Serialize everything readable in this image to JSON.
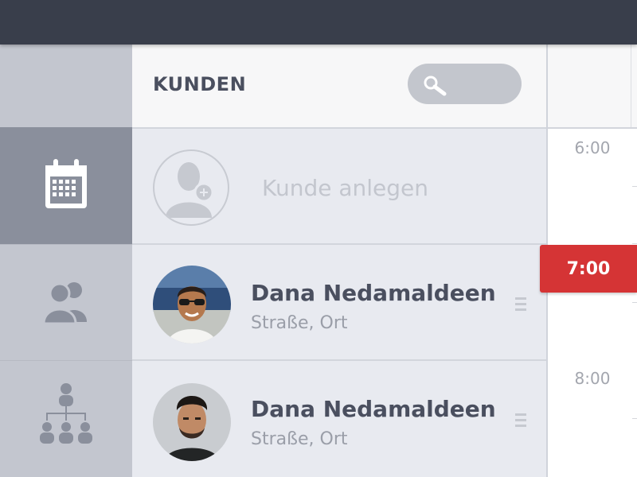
{
  "header": {
    "title": "KUNDEN"
  },
  "sidebar": {
    "items": [
      {
        "icon": "calendar-icon",
        "active": true
      },
      {
        "icon": "users-icon",
        "active": false
      },
      {
        "icon": "org-chart-icon",
        "active": false
      }
    ]
  },
  "add_customer": {
    "label": "Kunde anlegen"
  },
  "customers": [
    {
      "name": "Dana Nedamaldeen",
      "address": "Straße, Ort"
    },
    {
      "name": "Dana Nedamaldeen",
      "address": "Straße, Ort"
    }
  ],
  "timeline": {
    "times": [
      "6:00",
      "8:00"
    ],
    "current": "7:00"
  },
  "colors": {
    "topbar": "#393e4b",
    "sidebar": "#c3c6cf",
    "sidebar_active": "#8a8f9c",
    "accent_red": "#d53435"
  }
}
